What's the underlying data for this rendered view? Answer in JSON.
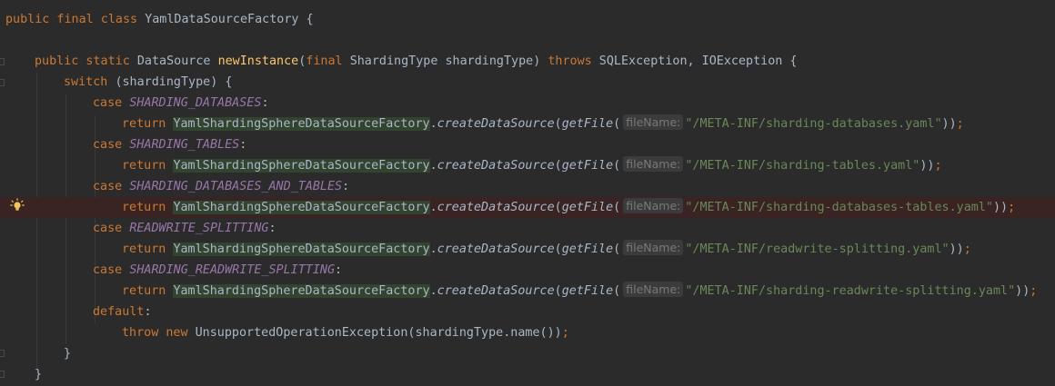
{
  "editor": {
    "lines": [
      {
        "id": "class-decl",
        "indent": 0,
        "tokens": [
          {
            "t": "public final class ",
            "c": "kw"
          },
          {
            "t": "YamlDataSourceFactory {",
            "c": ""
          }
        ]
      },
      {
        "id": "blank",
        "indent": 0,
        "tokens": []
      },
      {
        "id": "method-decl",
        "indent": 1,
        "tokens": [
          {
            "t": "public static ",
            "c": "kw"
          },
          {
            "t": "DataSource ",
            "c": ""
          },
          {
            "t": "newInstance",
            "c": "method"
          },
          {
            "t": "(",
            "c": ""
          },
          {
            "t": "final ",
            "c": "kw"
          },
          {
            "t": "ShardingType shardingType) ",
            "c": ""
          },
          {
            "t": "throws ",
            "c": "kw"
          },
          {
            "t": "SQLException, IOException {",
            "c": ""
          }
        ]
      },
      {
        "id": "switch",
        "indent": 2,
        "tokens": [
          {
            "t": "switch ",
            "c": "kw"
          },
          {
            "t": "(shardingType) {",
            "c": ""
          }
        ]
      },
      {
        "id": "case-1",
        "indent": 3,
        "tokens": [
          {
            "t": "case ",
            "c": "kw"
          },
          {
            "t": "SHARDING_DATABASES",
            "c": "enum"
          },
          {
            "t": ":",
            "c": ""
          }
        ]
      },
      {
        "id": "return-1",
        "indent": 4,
        "tokens": [
          {
            "t": "return ",
            "c": "kw"
          },
          {
            "t": "YamlShardingSphereDataSourceFactory",
            "c": "cls-hl"
          },
          {
            "t": ".",
            "c": ""
          },
          {
            "t": "createDataSource",
            "c": "static-call"
          },
          {
            "t": "(",
            "c": ""
          },
          {
            "t": "getFile",
            "c": "static-call"
          },
          {
            "t": "(",
            "c": ""
          },
          {
            "t": "fileName:",
            "c": "hint"
          },
          {
            "t": "\"/META-INF/sharding-databases.yaml\"",
            "c": "str"
          },
          {
            "t": "))",
            "c": ""
          },
          {
            "t": ";",
            "c": "kw"
          }
        ]
      },
      {
        "id": "case-2",
        "indent": 3,
        "tokens": [
          {
            "t": "case ",
            "c": "kw"
          },
          {
            "t": "SHARDING_TABLES",
            "c": "enum"
          },
          {
            "t": ":",
            "c": ""
          }
        ]
      },
      {
        "id": "return-2",
        "indent": 4,
        "tokens": [
          {
            "t": "return ",
            "c": "kw"
          },
          {
            "t": "YamlShardingSphereDataSourceFactory",
            "c": "cls-hl"
          },
          {
            "t": ".",
            "c": ""
          },
          {
            "t": "createDataSource",
            "c": "static-call"
          },
          {
            "t": "(",
            "c": ""
          },
          {
            "t": "getFile",
            "c": "static-call"
          },
          {
            "t": "(",
            "c": ""
          },
          {
            "t": "fileName:",
            "c": "hint"
          },
          {
            "t": "\"/META-INF/sharding-tables.yaml\"",
            "c": "str"
          },
          {
            "t": "))",
            "c": ""
          },
          {
            "t": ";",
            "c": "kw"
          }
        ]
      },
      {
        "id": "case-3",
        "indent": 3,
        "tokens": [
          {
            "t": "case ",
            "c": "kw"
          },
          {
            "t": "SHARDING_DATABASES_AND_TABLES",
            "c": "enum"
          },
          {
            "t": ":",
            "c": ""
          }
        ]
      },
      {
        "id": "return-3",
        "indent": 4,
        "highlighted": true,
        "tokens": [
          {
            "t": "return ",
            "c": "kw"
          },
          {
            "t": "YamlShardingSphereDataSourceFactory",
            "c": "cls-hl"
          },
          {
            "t": ".",
            "c": ""
          },
          {
            "t": "createDataSource",
            "c": "static-call"
          },
          {
            "t": "(",
            "c": ""
          },
          {
            "t": "getFile",
            "c": "static-call"
          },
          {
            "t": "(",
            "c": ""
          },
          {
            "t": "fileName:",
            "c": "hint"
          },
          {
            "t": "\"/META-INF/sharding-databases-tables.yaml\"",
            "c": "str"
          },
          {
            "t": "))",
            "c": ""
          },
          {
            "t": ";",
            "c": "kw"
          }
        ]
      },
      {
        "id": "case-4",
        "indent": 3,
        "tokens": [
          {
            "t": "case ",
            "c": "kw"
          },
          {
            "t": "READWRITE_SPLITTING",
            "c": "enum"
          },
          {
            "t": ":",
            "c": ""
          }
        ]
      },
      {
        "id": "return-4",
        "indent": 4,
        "tokens": [
          {
            "t": "return ",
            "c": "kw"
          },
          {
            "t": "YamlShardingSphereDataSourceFactory",
            "c": "cls-hl"
          },
          {
            "t": ".",
            "c": ""
          },
          {
            "t": "createDataSource",
            "c": "static-call"
          },
          {
            "t": "(",
            "c": ""
          },
          {
            "t": "getFile",
            "c": "static-call"
          },
          {
            "t": "(",
            "c": ""
          },
          {
            "t": "fileName:",
            "c": "hint"
          },
          {
            "t": "\"/META-INF/readwrite-splitting.yaml\"",
            "c": "str"
          },
          {
            "t": "))",
            "c": ""
          },
          {
            "t": ";",
            "c": "kw"
          }
        ]
      },
      {
        "id": "case-5",
        "indent": 3,
        "tokens": [
          {
            "t": "case ",
            "c": "kw"
          },
          {
            "t": "SHARDING_READWRITE_SPLITTING",
            "c": "enum"
          },
          {
            "t": ":",
            "c": ""
          }
        ]
      },
      {
        "id": "return-5",
        "indent": 4,
        "tokens": [
          {
            "t": "return ",
            "c": "kw"
          },
          {
            "t": "YamlShardingSphereDataSourceFactory",
            "c": "cls-hl"
          },
          {
            "t": ".",
            "c": ""
          },
          {
            "t": "createDataSource",
            "c": "static-call"
          },
          {
            "t": "(",
            "c": ""
          },
          {
            "t": "getFile",
            "c": "static-call"
          },
          {
            "t": "(",
            "c": ""
          },
          {
            "t": "fileName:",
            "c": "hint"
          },
          {
            "t": "\"/META-INF/sharding-readwrite-splitting.yaml\"",
            "c": "str"
          },
          {
            "t": "))",
            "c": ""
          },
          {
            "t": ";",
            "c": "kw"
          }
        ]
      },
      {
        "id": "default",
        "indent": 3,
        "tokens": [
          {
            "t": "default",
            "c": "kw"
          },
          {
            "t": ":",
            "c": ""
          }
        ]
      },
      {
        "id": "throw",
        "indent": 4,
        "tokens": [
          {
            "t": "throw new ",
            "c": "kw"
          },
          {
            "t": "UnsupportedOperationException(shardingType.name())",
            "c": ""
          },
          {
            "t": ";",
            "c": "kw"
          }
        ]
      },
      {
        "id": "close-switch",
        "indent": 2,
        "tokens": [
          {
            "t": "}",
            "c": ""
          }
        ]
      },
      {
        "id": "close-method",
        "indent": 1,
        "tokens": [
          {
            "t": "}",
            "c": ""
          }
        ]
      }
    ],
    "intention_icon": "lightbulb-icon",
    "colors": {
      "background": "#2b2b2b",
      "keyword": "#cc7832",
      "method_decl": "#ffc66d",
      "enum_constant": "#9876aa",
      "string": "#6a8759",
      "default_text": "#a9b7c6",
      "highlighted_line": "#3a2323",
      "usage_highlight": "#32432f",
      "hint_background": "#3b3b3b"
    }
  }
}
